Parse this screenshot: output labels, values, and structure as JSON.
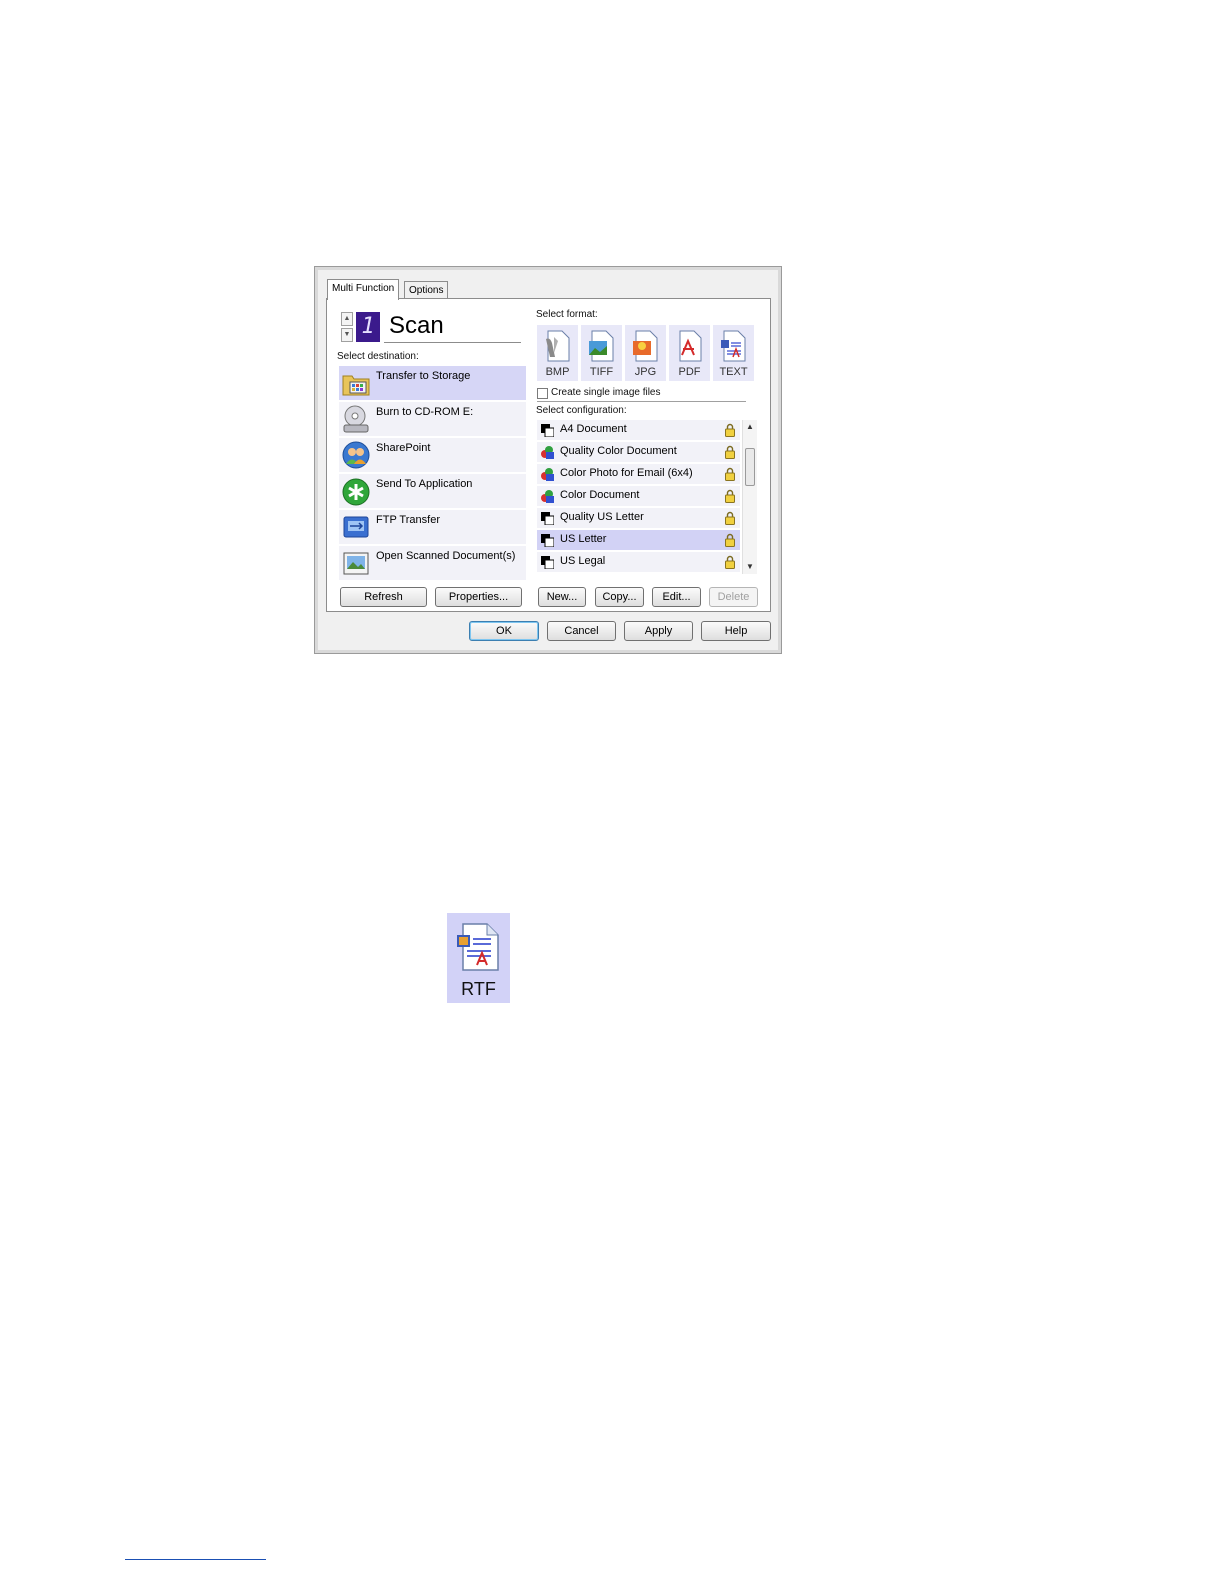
{
  "tabs": [
    "Multi Function",
    "Options"
  ],
  "scan": {
    "digit": "1",
    "title": "Scan"
  },
  "destination": {
    "label": "Select destination:",
    "items": [
      {
        "label": "Transfer to Storage",
        "icon": "folder-icon"
      },
      {
        "label": "Burn to CD-ROM  E:",
        "icon": "cd-drive-icon"
      },
      {
        "label": "SharePoint",
        "icon": "sharepoint-icon"
      },
      {
        "label": "Send To Application",
        "icon": "application-icon"
      },
      {
        "label": "FTP Transfer",
        "icon": "ftp-icon"
      },
      {
        "label": "Open Scanned Document(s)",
        "icon": "image-document-icon"
      }
    ],
    "selected_index": 0
  },
  "format": {
    "label": "Select format:",
    "items": [
      "BMP",
      "TIFF",
      "JPG",
      "PDF",
      "TEXT"
    ],
    "checkbox_label": "Create single image files"
  },
  "configuration": {
    "label": "Select configuration:",
    "items": [
      {
        "label": "A4 Document",
        "icon": "bw-document-icon"
      },
      {
        "label": "Quality Color Document",
        "icon": "color-document-icon"
      },
      {
        "label": "Color Photo for Email (6x4)",
        "icon": "color-document-icon"
      },
      {
        "label": "Color Document",
        "icon": "color-document-icon"
      },
      {
        "label": "Quality US Letter",
        "icon": "bw-document-icon"
      },
      {
        "label": "US Letter",
        "icon": "bw-document-icon"
      },
      {
        "label": "US Legal",
        "icon": "bw-document-icon"
      }
    ],
    "selected_index": 5
  },
  "buttons": {
    "refresh": "Refresh",
    "properties": "Properties...",
    "new": "New...",
    "copy": "Copy...",
    "edit": "Edit...",
    "delete": "Delete",
    "ok": "OK",
    "cancel": "Cancel",
    "apply": "Apply",
    "help": "Help"
  },
  "rtf_tile": {
    "label": "RTF"
  },
  "colors": {
    "selection": "#d6d6f6",
    "format_tile": "#e8e8f8",
    "rtf_tile": "#d2d2f7",
    "digit_bg": "#3b1a8c"
  }
}
